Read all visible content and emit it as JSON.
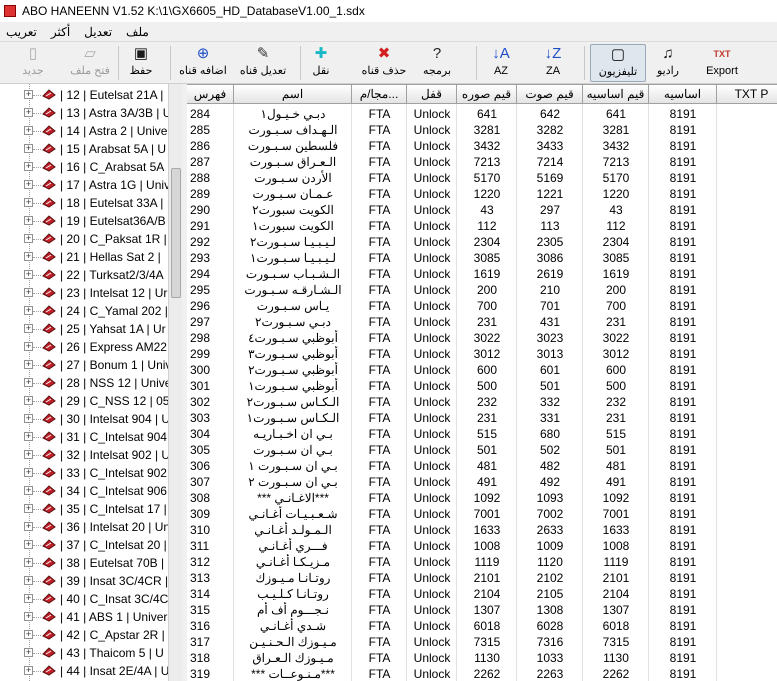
{
  "window": {
    "title": "ABO HANEENN    V1.52 K:\\1\\GX6605_HD_DatabaseV1.00_1.sdx"
  },
  "menu": [
    "تعريب",
    "أكثر",
    "تعديل",
    "ملف"
  ],
  "toolbar": [
    {
      "name": "new-button",
      "label": "جديد",
      "icon": "new-icon",
      "glyph": "▯",
      "color": "#aaaaaa",
      "disabled": true
    },
    {
      "name": "open-file-button",
      "label": "فتح ملف",
      "icon": "open-folder-icon",
      "glyph": "▱",
      "color": "#aaaaaa",
      "disabled": true
    },
    {
      "name": "save-button",
      "label": "حفظ",
      "icon": "floppy-icon",
      "glyph": "▣",
      "color": "#1a1a1a",
      "disabled": false
    },
    {
      "name": "add-channel-button",
      "label": "اضافه قناه",
      "icon": "plus-circle-icon",
      "glyph": "⊕",
      "color": "#1f4fc7",
      "disabled": false
    },
    {
      "name": "edit-channel-button",
      "label": "تعديل قناه",
      "icon": "edit-icon",
      "glyph": "✎",
      "color": "#333333",
      "disabled": false
    },
    {
      "name": "move-button",
      "label": "نقل",
      "icon": "move-cross-icon",
      "glyph": "✚",
      "color": "#19b7c8",
      "disabled": false
    },
    {
      "name": "delete-channel-button",
      "label": "حذف قناه",
      "icon": "delete-x-icon",
      "glyph": "✖",
      "color": "#d21f1f",
      "disabled": false
    },
    {
      "name": "programming-button",
      "label": "برمجه",
      "icon": "help-bulb-icon",
      "glyph": "?",
      "color": "#222222",
      "disabled": false
    },
    {
      "name": "sort-az-button",
      "label": "AZ",
      "icon": "sort-az-icon",
      "glyph": "↓A",
      "color": "#1f4fc7",
      "disabled": false
    },
    {
      "name": "sort-za-button",
      "label": "ZA",
      "icon": "sort-za-icon",
      "glyph": "↓Z",
      "color": "#1f4fc7",
      "disabled": false
    },
    {
      "name": "tv-button",
      "label": "تليفزيون",
      "icon": "tv-icon",
      "glyph": "▢",
      "color": "#111111",
      "disabled": false,
      "pressed": true
    },
    {
      "name": "radio-button",
      "label": "راديو",
      "icon": "music-note-icon",
      "glyph": "♫",
      "color": "#111111",
      "disabled": false
    },
    {
      "name": "export-button",
      "label": "Export",
      "icon": "export-txt-icon",
      "glyph": "TXT",
      "color": "#c0392b",
      "disabled": false
    }
  ],
  "satellites": [
    "| 12 | Eutelsat 21A  |",
    "| 13 | Astra 3A/3B | U",
    "| 14 | Astra 2 | Univer",
    "| 15 | Arabsat 5A | U",
    "| 16 | C_Arabsat 5A",
    "| 17 | Astra 1G | Univ",
    "| 18 | Eutelsat 33A |",
    "| 19 | Eutelsat36A/B",
    "| 20 | C_Paksat 1R |",
    "| 21 | Hellas Sat 2 |",
    "| 22 | Turksat2/3/4A",
    "| 23 | Intelsat 12 | Ur",
    "| 24 | C_Yamal 202 |",
    "| 25 | Yahsat 1A | Ur",
    "| 26 | Express AM22",
    "| 27 | Bonum 1 | Univ",
    "| 28 | NSS 12 | Unive",
    "| 29 | C_NSS 12 | 051",
    "| 30 | Intelsat 904 | U",
    "| 31 | C_Intelsat 904",
    "| 32 | Intelsat 902 | U",
    "| 33 | C_Intelsat 902",
    "| 34 | C_Intelsat 906",
    "| 35 | C_Intelsat 17 |",
    "| 36 | Intelsat 20 | Un",
    "| 37 | C_Intelsat 20 | C",
    "| 38 | Eutelsat 70B |",
    "| 39 | Insat 3C/4CR |",
    "| 40 | C_Insat 3C/4CF",
    "| 41 | ABS 1 | Univer",
    "| 42 | C_Apstar 2R |",
    "| 43 | Thaicom 5 | U",
    "| 44 | Insat 2E/4A | U"
  ],
  "columns": [
    "فهرس",
    "اسم",
    "مجا/م...",
    "قفل",
    "قيم صوره",
    "قيم صوت",
    "قيم اساسيه",
    "اساسيه",
    "TXT P"
  ],
  "rows": [
    [
      "284",
      "دبـي خـيـول١",
      "FTA",
      "Unlock",
      "641",
      "642",
      "641",
      "8191"
    ],
    [
      "285",
      "الـهـداف سـبـورت",
      "FTA",
      "Unlock",
      "3281",
      "3282",
      "3281",
      "8191"
    ],
    [
      "286",
      "فلسطين سـبـورت",
      "FTA",
      "Unlock",
      "3432",
      "3433",
      "3432",
      "8191"
    ],
    [
      "287",
      "الـعـراق سـبـورت",
      "FTA",
      "Unlock",
      "7213",
      "7214",
      "7213",
      "8191"
    ],
    [
      "288",
      "الأردن سـبـورت",
      "FTA",
      "Unlock",
      "5170",
      "5169",
      "5170",
      "8191"
    ],
    [
      "289",
      "عـمـان سـبـورت",
      "FTA",
      "Unlock",
      "1220",
      "1221",
      "1220",
      "8191"
    ],
    [
      "290",
      "الكويت سبورت٢",
      "FTA",
      "Unlock",
      "43",
      "297",
      "43",
      "8191"
    ],
    [
      "291",
      "الكويت سبورت١",
      "FTA",
      "Unlock",
      "112",
      "113",
      "112",
      "8191"
    ],
    [
      "292",
      "لـيـبـيـا سـبـورت٢",
      "FTA",
      "Unlock",
      "2304",
      "2305",
      "2304",
      "8191"
    ],
    [
      "293",
      "لـيـبـيـا سـبـورت١",
      "FTA",
      "Unlock",
      "3085",
      "3086",
      "3085",
      "8191"
    ],
    [
      "294",
      "الـشـبـاب سـبـورت",
      "FTA",
      "Unlock",
      "1619",
      "2619",
      "1619",
      "8191"
    ],
    [
      "295",
      "الـشـارقـه سـبـورت",
      "FTA",
      "Unlock",
      "200",
      "210",
      "200",
      "8191"
    ],
    [
      "296",
      "يـاس سـبـورت",
      "FTA",
      "Unlock",
      "700",
      "701",
      "700",
      "8191"
    ],
    [
      "297",
      "دبـي سـبـورت٢",
      "FTA",
      "Unlock",
      "231",
      "431",
      "231",
      "8191"
    ],
    [
      "298",
      "أبوظبي سـبـورت٤",
      "FTA",
      "Unlock",
      "3022",
      "3023",
      "3022",
      "8191"
    ],
    [
      "299",
      "أبوظبي سـبـورت٣",
      "FTA",
      "Unlock",
      "3012",
      "3013",
      "3012",
      "8191"
    ],
    [
      "300",
      "أبوظبي سـبـورت٢",
      "FTA",
      "Unlock",
      "600",
      "601",
      "600",
      "8191"
    ],
    [
      "301",
      "أبوظبي سـبـورت١",
      "FTA",
      "Unlock",
      "500",
      "501",
      "500",
      "8191"
    ],
    [
      "302",
      "الـكـاس سـبـورت٢",
      "FTA",
      "Unlock",
      "232",
      "332",
      "232",
      "8191"
    ],
    [
      "303",
      "الـكـاس سـبـورت١",
      "FTA",
      "Unlock",
      "231",
      "331",
      "231",
      "8191"
    ],
    [
      "304",
      "بـي ان اخـبـاريـه",
      "FTA",
      "Unlock",
      "515",
      "680",
      "515",
      "8191"
    ],
    [
      "305",
      "بـي ان سـبـورت",
      "FTA",
      "Unlock",
      "501",
      "502",
      "501",
      "8191"
    ],
    [
      "306",
      "بـي ان سـبـورت ١",
      "FTA",
      "Unlock",
      "481",
      "482",
      "481",
      "8191"
    ],
    [
      "307",
      "بـي ان سـبـورت ٢",
      "FTA",
      "Unlock",
      "491",
      "492",
      "491",
      "8191"
    ],
    [
      "308",
      "***الاغـانـي ***",
      "FTA",
      "Unlock",
      "1092",
      "1093",
      "1092",
      "8191"
    ],
    [
      "309",
      "شـعـبـيـات أغـانـي",
      "FTA",
      "Unlock",
      "7001",
      "7002",
      "7001",
      "8191"
    ],
    [
      "310",
      "الـمـولـد أغـانـي",
      "FTA",
      "Unlock",
      "1633",
      "2633",
      "1633",
      "8191"
    ],
    [
      "311",
      "فـــري أغـانـي",
      "FTA",
      "Unlock",
      "1008",
      "1009",
      "1008",
      "8191"
    ],
    [
      "312",
      "مـزيـكـا أغـانـي",
      "FTA",
      "Unlock",
      "1119",
      "1120",
      "1119",
      "8191"
    ],
    [
      "313",
      "روتـانـا مـيـوزك",
      "FTA",
      "Unlock",
      "2101",
      "2102",
      "2101",
      "8191"
    ],
    [
      "314",
      "روتـانـا كـلـيـب",
      "FTA",
      "Unlock",
      "2104",
      "2105",
      "2104",
      "8191"
    ],
    [
      "315",
      "نـجـــوم أف أم",
      "FTA",
      "Unlock",
      "1307",
      "1308",
      "1307",
      "8191"
    ],
    [
      "316",
      "شـدي أغـانـي",
      "FTA",
      "Unlock",
      "6018",
      "6028",
      "6018",
      "8191"
    ],
    [
      "317",
      "مـيـوزك الـحـنـيـن",
      "FTA",
      "Unlock",
      "7315",
      "7316",
      "7315",
      "8191"
    ],
    [
      "318",
      "مـيـوزك الـعـراق",
      "FTA",
      "Unlock",
      "1130",
      "1033",
      "1130",
      "8191"
    ],
    [
      "319",
      "***مـنـوعــات ***",
      "FTA",
      "Unlock",
      "2262",
      "2263",
      "2262",
      "8191"
    ]
  ]
}
